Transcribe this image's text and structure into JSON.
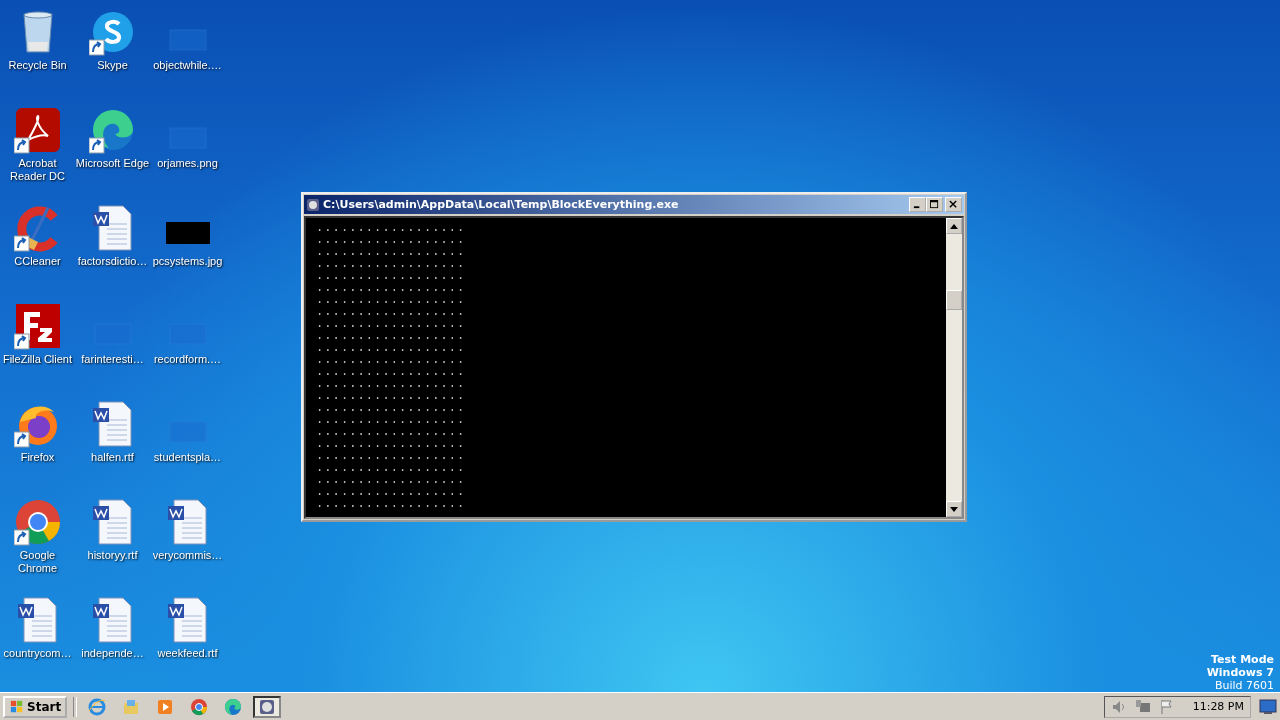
{
  "desktop": {
    "icons": [
      {
        "label": "Recycle Bin",
        "kind": "recycle-bin",
        "shortcut": false
      },
      {
        "label": "Acrobat Reader DC",
        "kind": "acrobat",
        "shortcut": true
      },
      {
        "label": "CCleaner",
        "kind": "ccleaner",
        "shortcut": true
      },
      {
        "label": "FileZilla Client",
        "kind": "filezilla",
        "shortcut": true
      },
      {
        "label": "Firefox",
        "kind": "firefox",
        "shortcut": true
      },
      {
        "label": "Google Chrome",
        "kind": "chrome",
        "shortcut": true
      },
      {
        "label": "countrycom…",
        "kind": "word",
        "shortcut": false
      },
      {
        "label": "Skype",
        "kind": "skype",
        "shortcut": true
      },
      {
        "label": "Microsoft Edge",
        "kind": "edge",
        "shortcut": true
      },
      {
        "label": "factorsdictio…",
        "kind": "word",
        "shortcut": false
      },
      {
        "label": "farinteresti…",
        "kind": "blank",
        "shortcut": false
      },
      {
        "label": "halfen.rtf",
        "kind": "word",
        "shortcut": false
      },
      {
        "label": "historyy.rtf",
        "kind": "word",
        "shortcut": false
      },
      {
        "label": "independe…",
        "kind": "word",
        "shortcut": false
      },
      {
        "label": "objectwhile.…",
        "kind": "blank",
        "shortcut": false
      },
      {
        "label": "orjames.png",
        "kind": "blank",
        "shortcut": false
      },
      {
        "label": "pcsystems.jpg",
        "kind": "black-image",
        "shortcut": false
      },
      {
        "label": "recordform.…",
        "kind": "blank",
        "shortcut": false
      },
      {
        "label": "studentspla…",
        "kind": "blank",
        "shortcut": false
      },
      {
        "label": "verycommis…",
        "kind": "word",
        "shortcut": false
      },
      {
        "label": "weekfeed.rtf",
        "kind": "word",
        "shortcut": false
      }
    ]
  },
  "console_window": {
    "title": "C:\\Users\\admin\\AppData\\Local\\Temp\\BlockEverything.exe",
    "lines": [
      "..................",
      "..................",
      "..................",
      "..................",
      "..................",
      "..................",
      "..................",
      "..................",
      "..................",
      "..................",
      "..................",
      "..................",
      "..................",
      "..................",
      "..................",
      "..................",
      "..................",
      "..................",
      "..................",
      "..................",
      "..................",
      "..................",
      "..................",
      ".................."
    ]
  },
  "os_notice": [
    "Test Mode",
    "Windows 7",
    "Build 7601"
  ],
  "taskbar": {
    "start": "Start",
    "buttons": [
      {
        "kind": "ie",
        "selected": false
      },
      {
        "kind": "explorer",
        "selected": false
      },
      {
        "kind": "media",
        "selected": false
      },
      {
        "kind": "chrome",
        "selected": false
      },
      {
        "kind": "edge",
        "selected": false
      },
      {
        "kind": "console",
        "selected": true
      }
    ],
    "clock": "11:28 PM"
  }
}
